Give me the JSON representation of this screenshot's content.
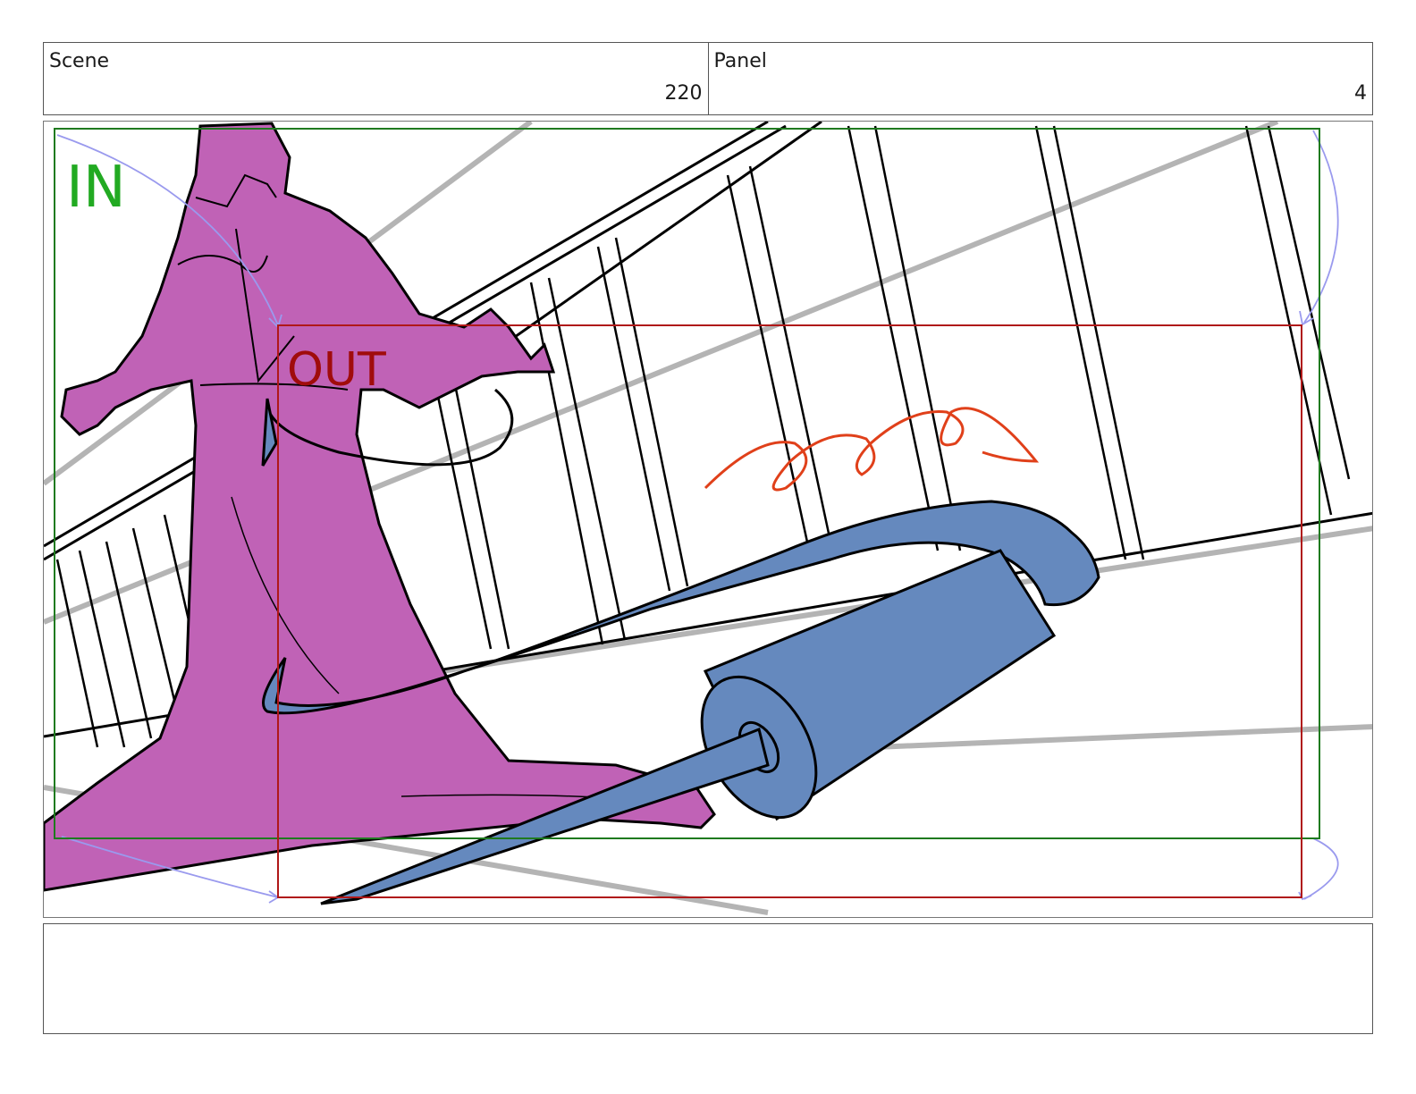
{
  "header": {
    "scene_label": "Scene",
    "scene_value": "220",
    "panel_label": "Panel",
    "panel_value": "4"
  },
  "frame": {
    "in_label": "IN",
    "out_label": "OUT",
    "colors": {
      "in_box": "#1f7a1f",
      "in_text": "#22aa22",
      "out_box": "#b01818",
      "out_text": "#a00c0c",
      "figure": "#c062b6",
      "prop": "#6589be",
      "scribble": "#e0401a",
      "camera_arrow": "#9a9aee",
      "guide": "#b4b4b4"
    }
  },
  "notes": {
    "text": ""
  }
}
